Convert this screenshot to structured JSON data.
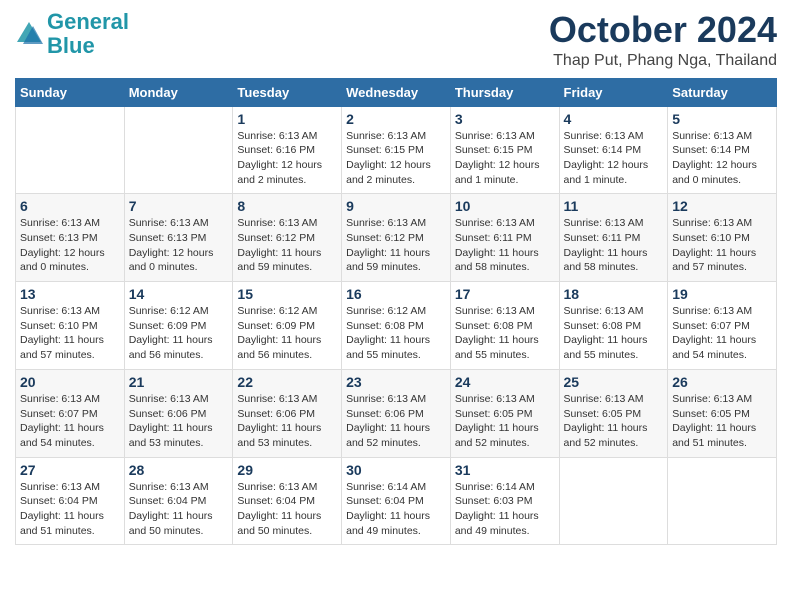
{
  "header": {
    "logo_line1": "General",
    "logo_line2": "Blue",
    "month": "October 2024",
    "location": "Thap Put, Phang Nga, Thailand"
  },
  "columns": [
    "Sunday",
    "Monday",
    "Tuesday",
    "Wednesday",
    "Thursday",
    "Friday",
    "Saturday"
  ],
  "weeks": [
    [
      {
        "day": "",
        "content": ""
      },
      {
        "day": "",
        "content": ""
      },
      {
        "day": "1",
        "content": "Sunrise: 6:13 AM\nSunset: 6:16 PM\nDaylight: 12 hours\nand 2 minutes."
      },
      {
        "day": "2",
        "content": "Sunrise: 6:13 AM\nSunset: 6:15 PM\nDaylight: 12 hours\nand 2 minutes."
      },
      {
        "day": "3",
        "content": "Sunrise: 6:13 AM\nSunset: 6:15 PM\nDaylight: 12 hours\nand 1 minute."
      },
      {
        "day": "4",
        "content": "Sunrise: 6:13 AM\nSunset: 6:14 PM\nDaylight: 12 hours\nand 1 minute."
      },
      {
        "day": "5",
        "content": "Sunrise: 6:13 AM\nSunset: 6:14 PM\nDaylight: 12 hours\nand 0 minutes."
      }
    ],
    [
      {
        "day": "6",
        "content": "Sunrise: 6:13 AM\nSunset: 6:13 PM\nDaylight: 12 hours\nand 0 minutes."
      },
      {
        "day": "7",
        "content": "Sunrise: 6:13 AM\nSunset: 6:13 PM\nDaylight: 12 hours\nand 0 minutes."
      },
      {
        "day": "8",
        "content": "Sunrise: 6:13 AM\nSunset: 6:12 PM\nDaylight: 11 hours\nand 59 minutes."
      },
      {
        "day": "9",
        "content": "Sunrise: 6:13 AM\nSunset: 6:12 PM\nDaylight: 11 hours\nand 59 minutes."
      },
      {
        "day": "10",
        "content": "Sunrise: 6:13 AM\nSunset: 6:11 PM\nDaylight: 11 hours\nand 58 minutes."
      },
      {
        "day": "11",
        "content": "Sunrise: 6:13 AM\nSunset: 6:11 PM\nDaylight: 11 hours\nand 58 minutes."
      },
      {
        "day": "12",
        "content": "Sunrise: 6:13 AM\nSunset: 6:10 PM\nDaylight: 11 hours\nand 57 minutes."
      }
    ],
    [
      {
        "day": "13",
        "content": "Sunrise: 6:13 AM\nSunset: 6:10 PM\nDaylight: 11 hours\nand 57 minutes."
      },
      {
        "day": "14",
        "content": "Sunrise: 6:12 AM\nSunset: 6:09 PM\nDaylight: 11 hours\nand 56 minutes."
      },
      {
        "day": "15",
        "content": "Sunrise: 6:12 AM\nSunset: 6:09 PM\nDaylight: 11 hours\nand 56 minutes."
      },
      {
        "day": "16",
        "content": "Sunrise: 6:12 AM\nSunset: 6:08 PM\nDaylight: 11 hours\nand 55 minutes."
      },
      {
        "day": "17",
        "content": "Sunrise: 6:13 AM\nSunset: 6:08 PM\nDaylight: 11 hours\nand 55 minutes."
      },
      {
        "day": "18",
        "content": "Sunrise: 6:13 AM\nSunset: 6:08 PM\nDaylight: 11 hours\nand 55 minutes."
      },
      {
        "day": "19",
        "content": "Sunrise: 6:13 AM\nSunset: 6:07 PM\nDaylight: 11 hours\nand 54 minutes."
      }
    ],
    [
      {
        "day": "20",
        "content": "Sunrise: 6:13 AM\nSunset: 6:07 PM\nDaylight: 11 hours\nand 54 minutes."
      },
      {
        "day": "21",
        "content": "Sunrise: 6:13 AM\nSunset: 6:06 PM\nDaylight: 11 hours\nand 53 minutes."
      },
      {
        "day": "22",
        "content": "Sunrise: 6:13 AM\nSunset: 6:06 PM\nDaylight: 11 hours\nand 53 minutes."
      },
      {
        "day": "23",
        "content": "Sunrise: 6:13 AM\nSunset: 6:06 PM\nDaylight: 11 hours\nand 52 minutes."
      },
      {
        "day": "24",
        "content": "Sunrise: 6:13 AM\nSunset: 6:05 PM\nDaylight: 11 hours\nand 52 minutes."
      },
      {
        "day": "25",
        "content": "Sunrise: 6:13 AM\nSunset: 6:05 PM\nDaylight: 11 hours\nand 52 minutes."
      },
      {
        "day": "26",
        "content": "Sunrise: 6:13 AM\nSunset: 6:05 PM\nDaylight: 11 hours\nand 51 minutes."
      }
    ],
    [
      {
        "day": "27",
        "content": "Sunrise: 6:13 AM\nSunset: 6:04 PM\nDaylight: 11 hours\nand 51 minutes."
      },
      {
        "day": "28",
        "content": "Sunrise: 6:13 AM\nSunset: 6:04 PM\nDaylight: 11 hours\nand 50 minutes."
      },
      {
        "day": "29",
        "content": "Sunrise: 6:13 AM\nSunset: 6:04 PM\nDaylight: 11 hours\nand 50 minutes."
      },
      {
        "day": "30",
        "content": "Sunrise: 6:14 AM\nSunset: 6:04 PM\nDaylight: 11 hours\nand 49 minutes."
      },
      {
        "day": "31",
        "content": "Sunrise: 6:14 AM\nSunset: 6:03 PM\nDaylight: 11 hours\nand 49 minutes."
      },
      {
        "day": "",
        "content": ""
      },
      {
        "day": "",
        "content": ""
      }
    ]
  ]
}
